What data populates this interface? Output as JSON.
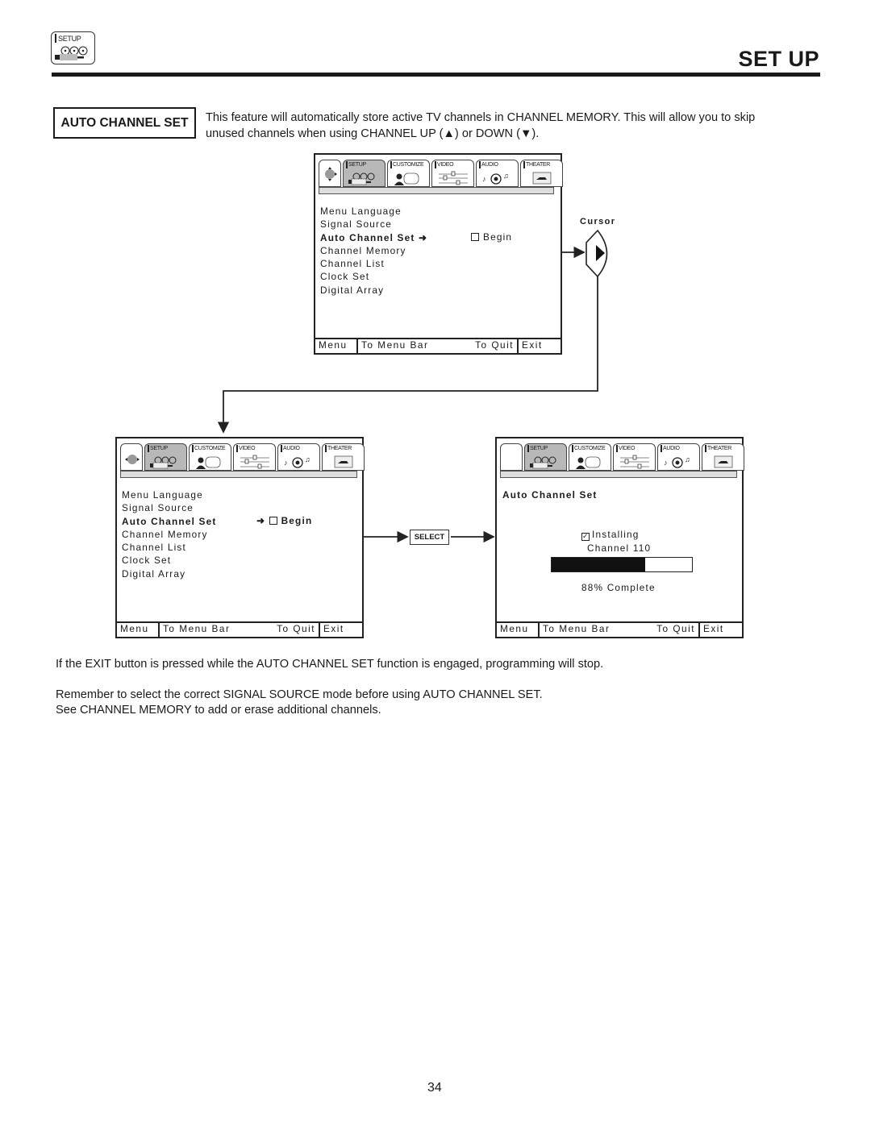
{
  "header": {
    "icon_label": "SETUP",
    "page_title": "SET UP"
  },
  "section": {
    "title": "AUTO CHANNEL SET",
    "intro_line1": "This feature will automatically store active TV channels in CHANNEL MEMORY.  This will allow you to skip",
    "intro_line2": "unused channels when using CHANNEL UP (▲) or DOWN (▼)."
  },
  "tabs": [
    "SETUP",
    "CUSTOMIZE",
    "VIDEO",
    "AUDIO",
    "THEATER"
  ],
  "menu_items": [
    "Menu Language",
    "Signal Source",
    "Auto Channel Set",
    "Channel Memory",
    "Channel List",
    "Clock Set",
    "Digital Array"
  ],
  "selected_item": "Auto Channel Set",
  "begin_label": "Begin",
  "footer": {
    "menu": "Menu",
    "to_menu_bar": "To Menu Bar",
    "to_quit": "To Quit",
    "exit": "Exit"
  },
  "cursor_label": "Cursor",
  "select_button": "SELECT",
  "install_screen": {
    "title": "Auto Channel Set",
    "status": "Installing",
    "channel": "Channel 110",
    "progress_percent": 88,
    "progress_label": "88% Complete"
  },
  "notes": [
    "If the EXIT button is pressed while the AUTO CHANNEL SET function is engaged, programming will stop.",
    "Remember to select the correct SIGNAL SOURCE mode before using AUTO CHANNEL SET.",
    "See CHANNEL MEMORY to add or erase additional channels."
  ],
  "page_number": "34"
}
